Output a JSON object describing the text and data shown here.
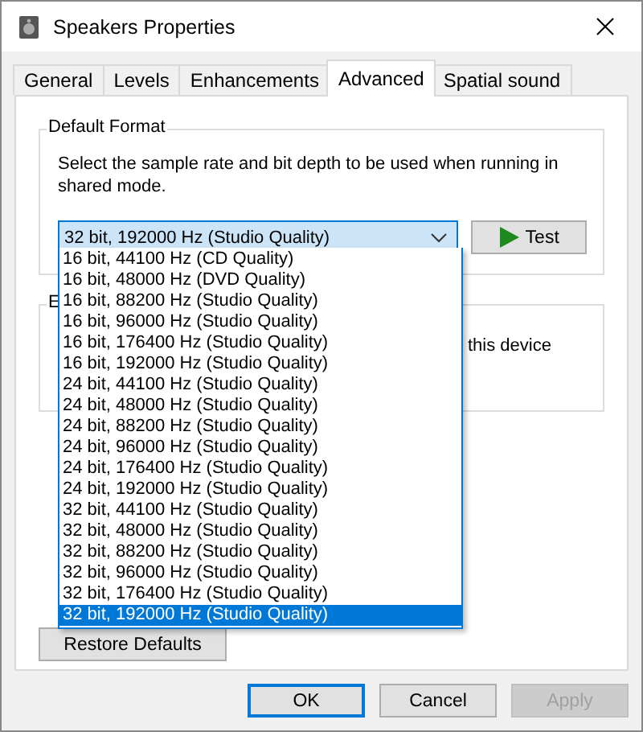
{
  "window": {
    "title": "Speakers Properties"
  },
  "tabs": [
    {
      "label": "General",
      "selected": false
    },
    {
      "label": "Levels",
      "selected": false
    },
    {
      "label": "Enhancements",
      "selected": false
    },
    {
      "label": "Advanced",
      "selected": true
    },
    {
      "label": "Spatial sound",
      "selected": false
    }
  ],
  "default_format": {
    "title": "Default Format",
    "description": "Select the sample rate and bit depth to be used when running in shared mode.",
    "combo_value": "32 bit, 192000 Hz (Studio Quality)",
    "test_button": "Test"
  },
  "exclusive_group": {
    "title": "E",
    "text": "this device"
  },
  "restore_button": "Restore Defaults",
  "dropdown": {
    "options": [
      {
        "label": "16 bit, 44100 Hz (CD Quality)",
        "selected": false
      },
      {
        "label": "16 bit, 48000 Hz (DVD Quality)",
        "selected": false
      },
      {
        "label": "16 bit, 88200 Hz (Studio Quality)",
        "selected": false
      },
      {
        "label": "16 bit, 96000 Hz (Studio Quality)",
        "selected": false
      },
      {
        "label": "16 bit, 176400 Hz (Studio Quality)",
        "selected": false
      },
      {
        "label": "16 bit, 192000 Hz (Studio Quality)",
        "selected": false
      },
      {
        "label": "24 bit, 44100 Hz (Studio Quality)",
        "selected": false
      },
      {
        "label": "24 bit, 48000 Hz (Studio Quality)",
        "selected": false
      },
      {
        "label": "24 bit, 88200 Hz (Studio Quality)",
        "selected": false
      },
      {
        "label": "24 bit, 96000 Hz (Studio Quality)",
        "selected": false
      },
      {
        "label": "24 bit, 176400 Hz (Studio Quality)",
        "selected": false
      },
      {
        "label": "24 bit, 192000 Hz (Studio Quality)",
        "selected": false
      },
      {
        "label": "32 bit, 44100 Hz (Studio Quality)",
        "selected": false
      },
      {
        "label": "32 bit, 48000 Hz (Studio Quality)",
        "selected": false
      },
      {
        "label": "32 bit, 88200 Hz (Studio Quality)",
        "selected": false
      },
      {
        "label": "32 bit, 96000 Hz (Studio Quality)",
        "selected": false
      },
      {
        "label": "32 bit, 176400 Hz (Studio Quality)",
        "selected": false
      },
      {
        "label": "32 bit, 192000 Hz (Studio Quality)",
        "selected": true
      }
    ]
  },
  "buttons": [
    {
      "label": "OK",
      "default": true,
      "disabled": false
    },
    {
      "label": "Cancel",
      "default": false,
      "disabled": false
    },
    {
      "label": "Apply",
      "default": false,
      "disabled": true
    }
  ]
}
